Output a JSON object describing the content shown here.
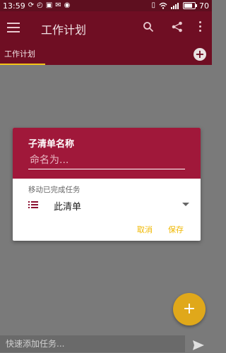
{
  "status_bar": {
    "time": "13:59",
    "left_icons": [
      "sync-icon",
      "notification-icon",
      "image-icon",
      "mail-icon",
      "android-icon"
    ],
    "right_icons": [
      "vibrate-icon",
      "wifi-icon",
      "signal-icon"
    ],
    "battery_level": "70"
  },
  "app_bar": {
    "title": "工作计划",
    "icons": [
      "menu-icon",
      "search-icon",
      "share-icon",
      "more-vert-icon"
    ]
  },
  "tabs": [
    {
      "label": "工作计划",
      "active": true
    }
  ],
  "dialog": {
    "title": "子清单名称",
    "input_placeholder": "命名为...",
    "input_value": "",
    "move_label": "移动已完成任务",
    "selected_list": "此清单",
    "cancel_label": "取消",
    "save_label": "保存"
  },
  "bottom": {
    "quick_add_placeholder": "快速添加任务..."
  },
  "colors": {
    "appbar": "#6f0e23",
    "dialog_header": "#a0183a",
    "accent": "#f0b800",
    "fab": "#e0a81a",
    "tab_indicator": "#f5c518"
  }
}
